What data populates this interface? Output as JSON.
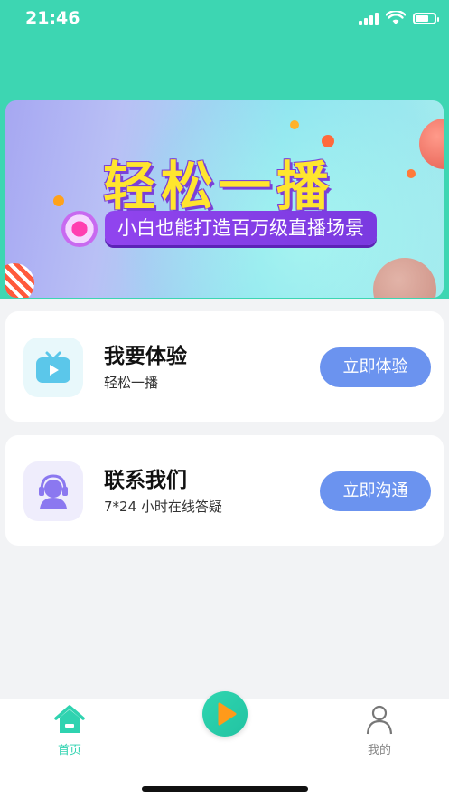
{
  "status_bar": {
    "time": "21:46"
  },
  "banner": {
    "title": "轻松一播",
    "subtitle": "小白也能打造百万级直播场景"
  },
  "cards": [
    {
      "title": "我要体验",
      "desc": "轻松一播",
      "button": "立即体验",
      "icon": "tv-play-icon"
    },
    {
      "title": "联系我们",
      "desc": "7*24 小时在线答疑",
      "button": "立即沟通",
      "icon": "customer-service-icon"
    }
  ],
  "tabbar": {
    "home_label": "首页",
    "mine_label": "我的",
    "active_color": "#2fd3b0",
    "inactive_color": "#888888"
  },
  "colors": {
    "accent": "#3dd6b2",
    "button": "#6b93ef",
    "banner_title": "#ffe52e",
    "banner_sub_bg": "#8a40ea"
  }
}
